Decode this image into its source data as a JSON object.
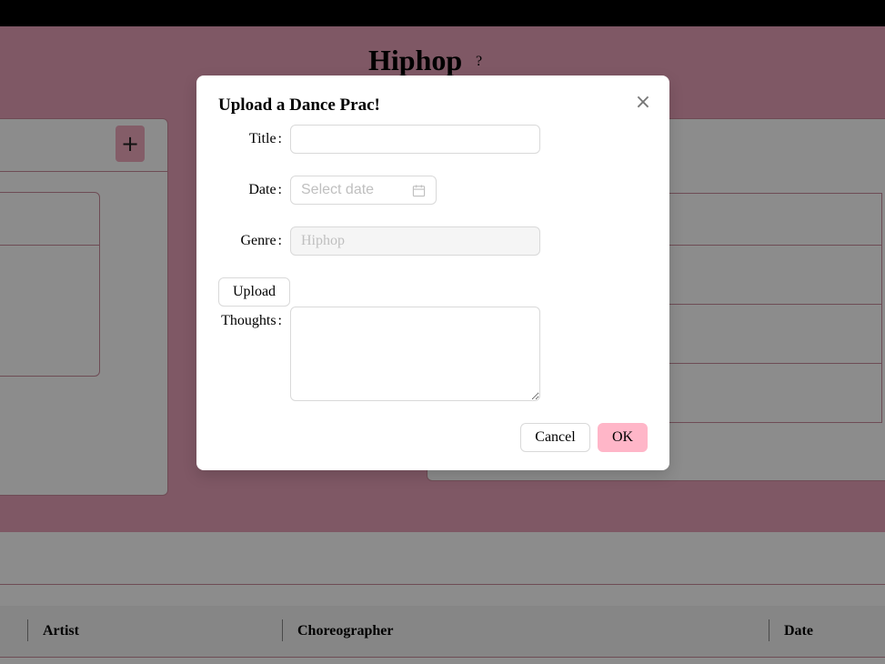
{
  "page": {
    "title": "Hiphop",
    "help_mark": "?"
  },
  "left_panel": {
    "add_icon": "+"
  },
  "table": {
    "columns": [
      "Artist",
      "Choreographer",
      "Date"
    ]
  },
  "modal": {
    "title": "Upload a Dance Prac!",
    "close_icon": "×",
    "fields": {
      "title_label": "Title",
      "title_value": "",
      "date_label": "Date",
      "date_placeholder": "Select date",
      "genre_label": "Genre",
      "genre_value": "Hiphop",
      "thoughts_label": "Thoughts",
      "thoughts_value": ""
    },
    "upload_label": "Upload",
    "cancel_label": "Cancel",
    "ok_label": "OK"
  },
  "colors": {
    "header_pink": "#e8a1b8",
    "ok_button": "#ffb6c8",
    "border_pink": "#c98a9c"
  },
  "icons": {
    "close": "close-icon",
    "calendar": "calendar-icon",
    "add": "plus-icon"
  }
}
